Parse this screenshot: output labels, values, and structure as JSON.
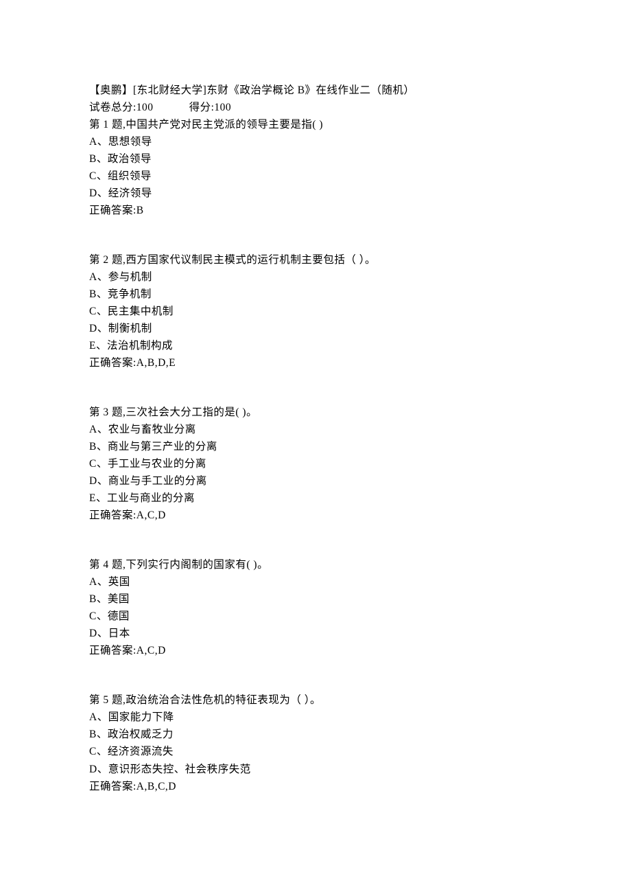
{
  "header": {
    "title": "【奥鹏】[东北财经大学]东财《政治学概论 B》在线作业二（随机）",
    "total_score_label": "试卷总分:100",
    "got_score_label": "得分:100"
  },
  "questions": [
    {
      "prompt": "第 1 题,中国共产党对民主党派的领导主要是指(  )",
      "options": [
        "A、思想领导",
        "B、政治领导",
        "C、组织领导",
        "D、经济领导"
      ],
      "answer": "正确答案:B"
    },
    {
      "prompt": "第 2 题,西方国家代议制民主模式的运行机制主要包括（  ）。",
      "options": [
        "A、参与机制",
        "B、竞争机制",
        "C、民主集中机制",
        "D、制衡机制",
        "E、法治机制构成"
      ],
      "answer": "正确答案:A,B,D,E"
    },
    {
      "prompt": "第 3 题,三次社会大分工指的是(  )。",
      "options": [
        "A、农业与畜牧业分离",
        "B、商业与第三产业的分离",
        "C、手工业与农业的分离",
        "D、商业与手工业的分离",
        "E、工业与商业的分离"
      ],
      "answer": "正确答案:A,C,D"
    },
    {
      "prompt": "第 4 题,下列实行内阁制的国家有(  )。",
      "options": [
        "A、英国",
        "B、美国",
        "C、德国",
        "D、日本"
      ],
      "answer": "正确答案:A,C,D"
    },
    {
      "prompt": "第 5 题,政治统治合法性危机的特征表现为（   ）。",
      "options": [
        "A、国家能力下降",
        "B、政治权威乏力",
        "C、经济资源流失",
        "D、意识形态失控、社会秩序失范"
      ],
      "answer": "正确答案:A,B,C,D"
    }
  ]
}
